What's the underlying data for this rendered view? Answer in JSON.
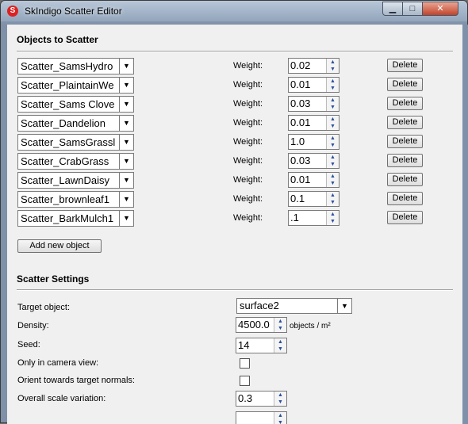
{
  "window": {
    "title": "SkIndigo Scatter Editor",
    "app_icon_glyph": "S",
    "minimize_glyph": "▁",
    "maximize_glyph": "□",
    "close_glyph": "✕"
  },
  "objects_section": {
    "title": "Objects to Scatter",
    "weight_label": "Weight:",
    "delete_label": "Delete",
    "add_label": "Add new object",
    "items": [
      {
        "name": "Scatter_SamsHydro",
        "weight": "0.02"
      },
      {
        "name": "Scatter_PlaintainWe",
        "weight": "0.01"
      },
      {
        "name": "Scatter_Sams Clove",
        "weight": "0.03"
      },
      {
        "name": "Scatter_Dandelion",
        "weight": "0.01"
      },
      {
        "name": "Scatter_SamsGrassl",
        "weight": "1.0"
      },
      {
        "name": "Scatter_CrabGrass",
        "weight": "0.03"
      },
      {
        "name": "Scatter_LawnDaisy",
        "weight": "0.01"
      },
      {
        "name": "Scatter_brownleaf1",
        "weight": "0.1"
      },
      {
        "name": "Scatter_BarkMulch1",
        "weight": ".1"
      }
    ]
  },
  "settings_section": {
    "title": "Scatter Settings",
    "target_label": "Target object:",
    "target_value": "surface2",
    "density_label": "Density:",
    "density_value": "4500.0",
    "density_unit": "objects / m²",
    "seed_label": "Seed:",
    "seed_value": "14",
    "camera_label": "Only in camera view:",
    "orient_label": "Orient towards target normals:",
    "scale_label": "Overall scale variation:",
    "scale_value": "0.3"
  }
}
